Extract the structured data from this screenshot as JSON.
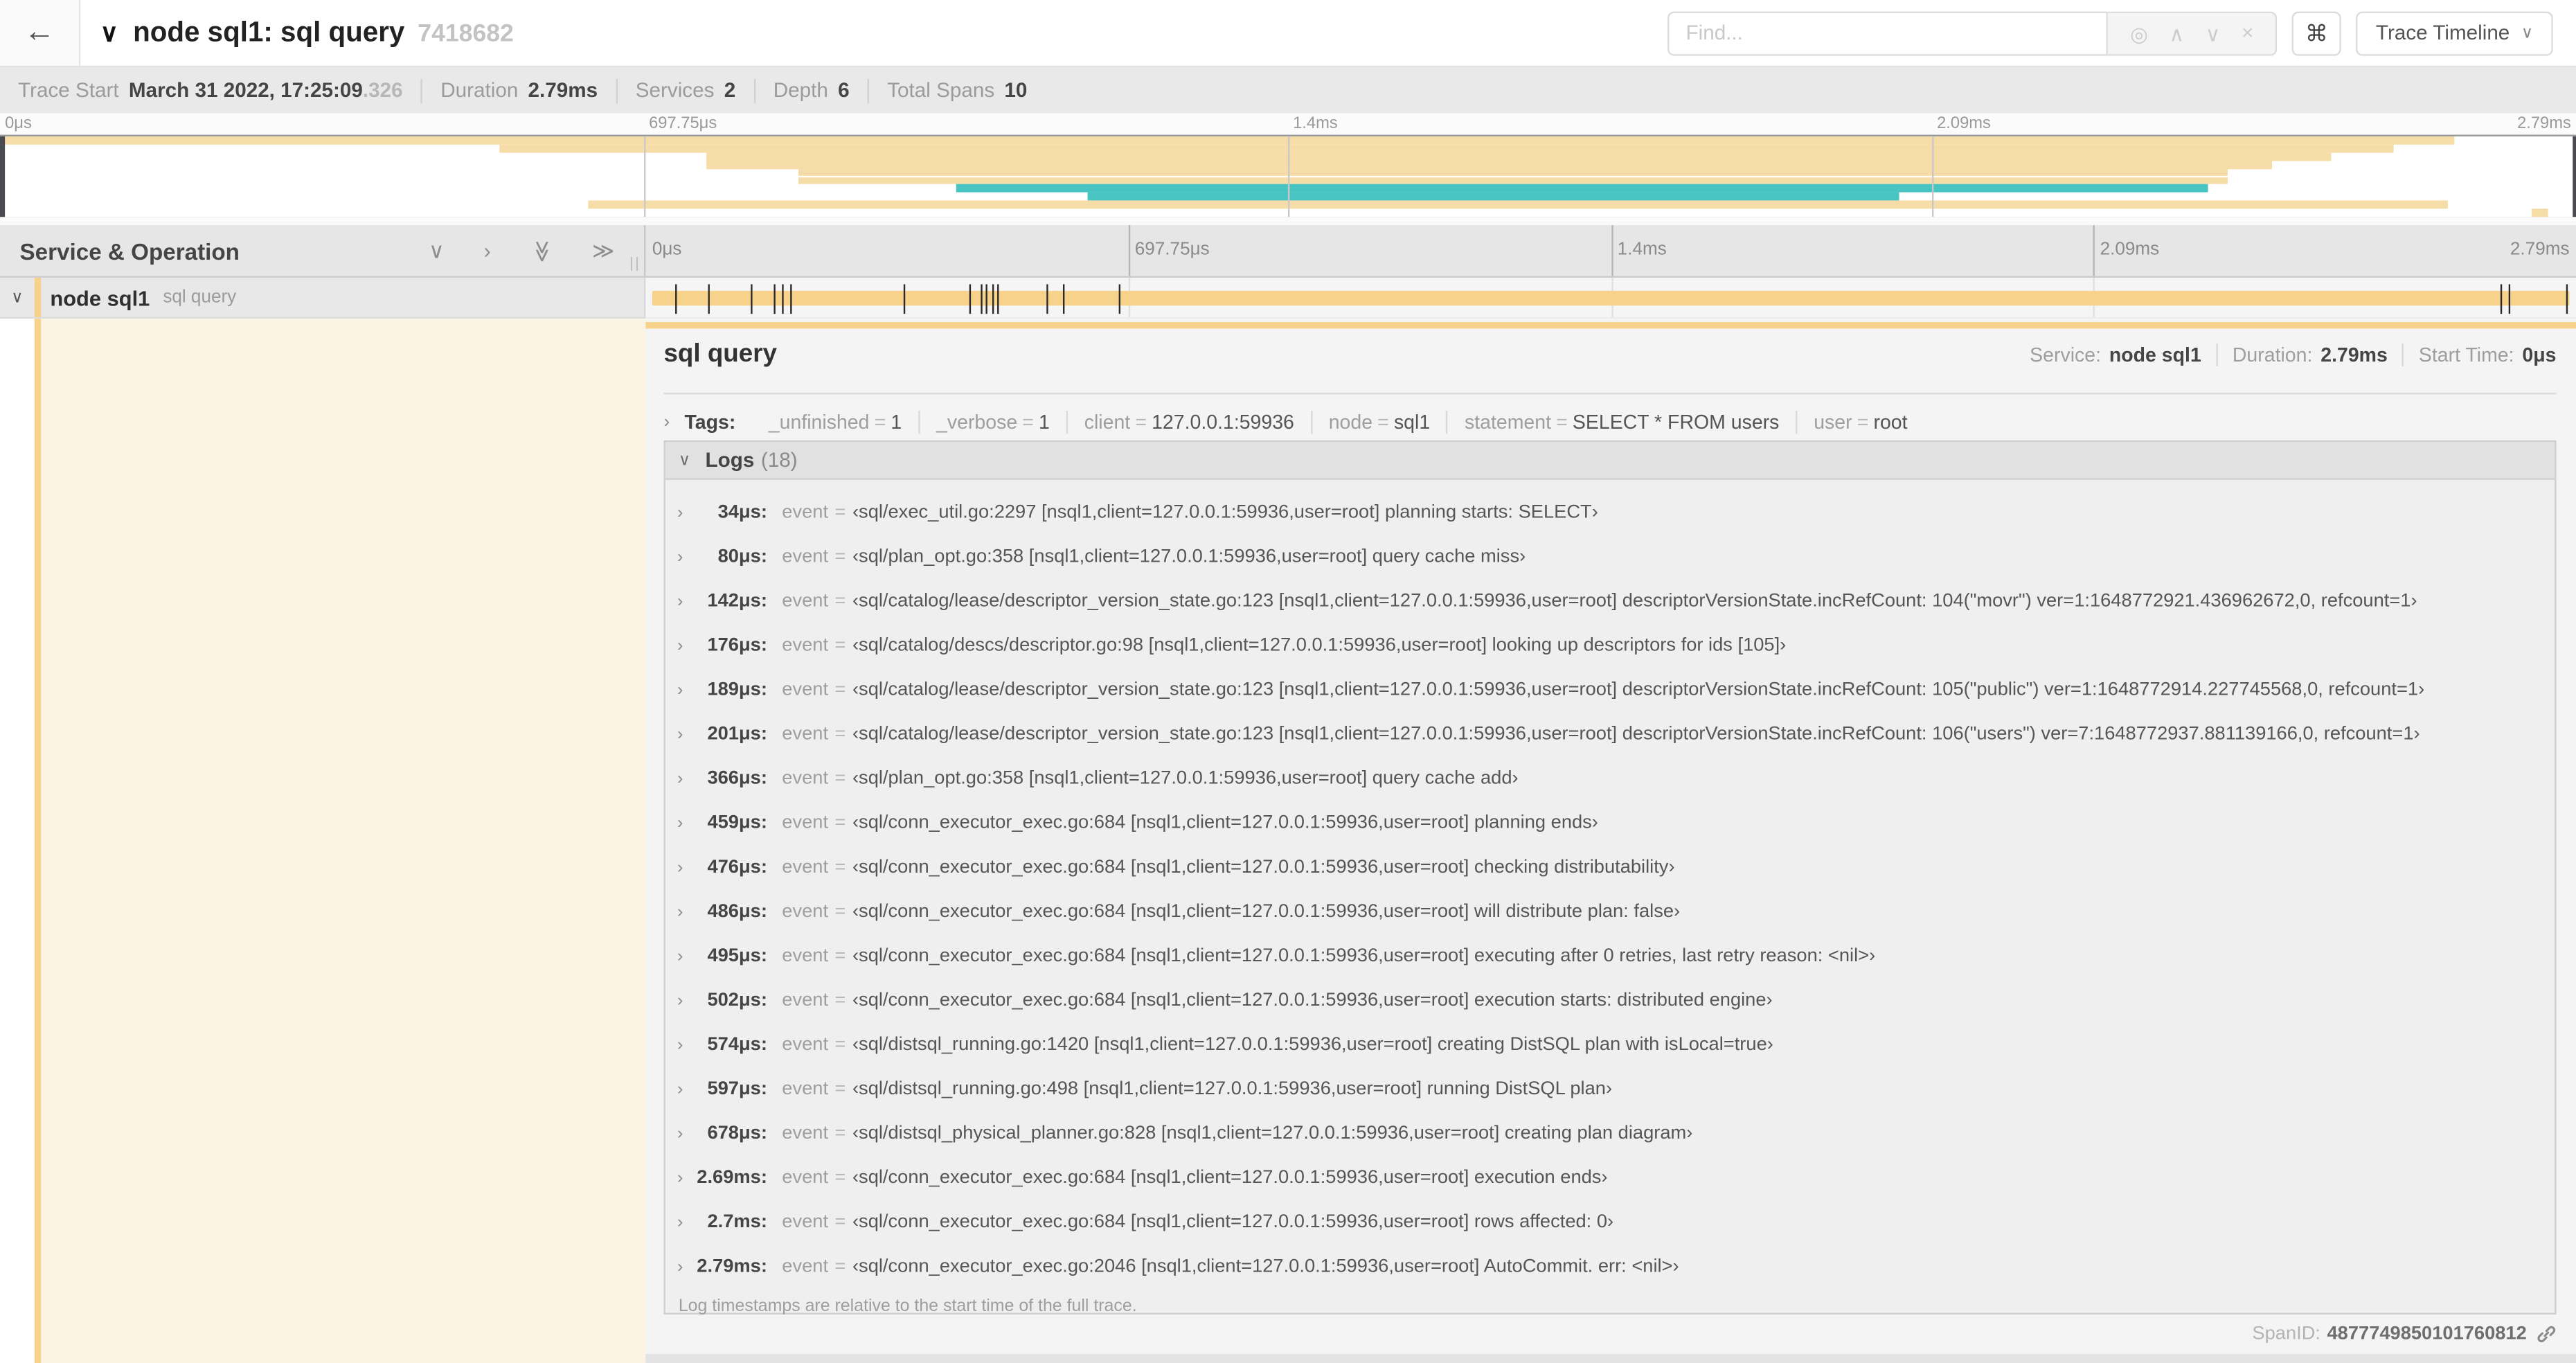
{
  "header": {
    "back_icon": "←",
    "collapse_icon": "∨",
    "title": "node sql1: sql query",
    "trace_id": "7418682",
    "find_placeholder": "Find...",
    "find_icons": [
      {
        "name": "locate-icon",
        "glyph": "◎"
      },
      {
        "name": "chevron-up-icon",
        "glyph": "∧"
      },
      {
        "name": "chevron-down-icon",
        "glyph": "∨"
      },
      {
        "name": "close-icon",
        "glyph": "×"
      }
    ],
    "shortcut_icon": "⌘",
    "view_selector": "Trace Timeline",
    "view_selector_chevron": "∨"
  },
  "trace_info": {
    "items": [
      {
        "label": "Trace Start",
        "value": "March 31 2022, 17:25:09",
        "suffix": ".326"
      },
      {
        "label": "Duration",
        "value": "2.79ms",
        "suffix": ""
      },
      {
        "label": "Services",
        "value": "2",
        "suffix": ""
      },
      {
        "label": "Depth",
        "value": "6",
        "suffix": ""
      },
      {
        "label": "Total Spans",
        "value": "10",
        "suffix": ""
      }
    ]
  },
  "minimap": {
    "time_labels": [
      "0μs",
      "697.75μs",
      "1.4ms",
      "2.09ms",
      "2.79ms"
    ],
    "label_positions": [
      0,
      25,
      50,
      75,
      100
    ],
    "colors": {
      "tan": "#F6DCA6",
      "teal": "#48C5C3"
    },
    "bars": [
      {
        "start": 0,
        "end": 95.3,
        "color": "tan"
      },
      {
        "start": 19.4,
        "end": 92.9,
        "color": "tan"
      },
      {
        "start": 27.4,
        "end": 90.5,
        "color": "tan"
      },
      {
        "start": 27.4,
        "end": 88.2,
        "color": "tan"
      },
      {
        "start": 31.0,
        "end": 86.5,
        "color": "tan"
      },
      {
        "start": 31.0,
        "end": 86.5,
        "color": "tan"
      },
      {
        "start": 37.1,
        "end": 85.7,
        "color": "teal"
      },
      {
        "start": 42.2,
        "end": 73.7,
        "color": "teal"
      },
      {
        "start": 22.8,
        "end": 95.0,
        "color": "tan"
      },
      {
        "start": 98.3,
        "end": 98.9,
        "color": "tan"
      }
    ]
  },
  "timeline": {
    "header": "Service & Operation",
    "header_icons": [
      {
        "name": "collapse-one-icon",
        "glyph": "∨",
        "rotate": false
      },
      {
        "name": "expand-one-icon",
        "glyph": "›",
        "rotate": false
      },
      {
        "name": "collapse-all-icon",
        "glyph": "≫",
        "rotate": true
      },
      {
        "name": "expand-all-icon",
        "glyph": "≫",
        "rotate": false
      }
    ],
    "grip": "||",
    "ruler_labels": [
      "0μs",
      "697.75μs",
      "1.4ms",
      "2.09ms",
      "2.79ms"
    ],
    "ruler_positions": [
      0,
      25,
      50,
      75,
      100
    ],
    "span": {
      "chevron": "∨",
      "service": "node sql1",
      "operation": "sql query",
      "bar_color": "#F7D28A"
    }
  },
  "detail": {
    "operation": "sql query",
    "summary": [
      {
        "label": "Service:",
        "value": "node sql1"
      },
      {
        "label": "Duration:",
        "value": "2.79ms"
      },
      {
        "label": "Start Time:",
        "value": "0μs"
      }
    ],
    "tags_chevron": "›",
    "tags_label": "Tags:",
    "tags": [
      {
        "key": "_unfinished",
        "value": "1"
      },
      {
        "key": "_verbose",
        "value": "1"
      },
      {
        "key": "client",
        "value": "127.0.0.1:59936"
      },
      {
        "key": "node",
        "value": "sql1"
      },
      {
        "key": "statement",
        "value": "SELECT * FROM users"
      },
      {
        "key": "user",
        "value": "root"
      }
    ],
    "logs_chevron": "∨",
    "logs_label": "Logs",
    "logs_count": "(18)",
    "logs": [
      {
        "time": "34μs:",
        "pct": 1.2,
        "key": "event",
        "value": "‹sql/exec_util.go:2297 [nsql1,client=127.0.0.1:59936,user=root] planning starts: SELECT›"
      },
      {
        "time": "80μs:",
        "pct": 2.9,
        "key": "event",
        "value": "‹sql/plan_opt.go:358 [nsql1,client=127.0.0.1:59936,user=root] query cache miss›"
      },
      {
        "time": "142μs:",
        "pct": 5.1,
        "key": "event",
        "value": "‹sql/catalog/lease/descriptor_version_state.go:123 [nsql1,client=127.0.0.1:59936,user=root] descriptorVersionState.incRefCount: 104(\"movr\") ver=1:1648772921.436962672,0, refcount=1›"
      },
      {
        "time": "176μs:",
        "pct": 6.3,
        "key": "event",
        "value": "‹sql/catalog/descs/descriptor.go:98 [nsql1,client=127.0.0.1:59936,user=root] looking up descriptors for ids [105]›"
      },
      {
        "time": "189μs:",
        "pct": 6.8,
        "key": "event",
        "value": "‹sql/catalog/lease/descriptor_version_state.go:123 [nsql1,client=127.0.0.1:59936,user=root] descriptorVersionState.incRefCount: 105(\"public\") ver=1:1648772914.227745568,0, refcount=1›"
      },
      {
        "time": "201μs:",
        "pct": 7.2,
        "key": "event",
        "value": "‹sql/catalog/lease/descriptor_version_state.go:123 [nsql1,client=127.0.0.1:59936,user=root] descriptorVersionState.incRefCount: 106(\"users\") ver=7:1648772937.881139166,0, refcount=1›"
      },
      {
        "time": "366μs:",
        "pct": 13.1,
        "key": "event",
        "value": "‹sql/plan_opt.go:358 [nsql1,client=127.0.0.1:59936,user=root] query cache add›"
      },
      {
        "time": "459μs:",
        "pct": 16.5,
        "key": "event",
        "value": "‹sql/conn_executor_exec.go:684 [nsql1,client=127.0.0.1:59936,user=root] planning ends›"
      },
      {
        "time": "476μs:",
        "pct": 17.1,
        "key": "event",
        "value": "‹sql/conn_executor_exec.go:684 [nsql1,client=127.0.0.1:59936,user=root] checking distributability›"
      },
      {
        "time": "486μs:",
        "pct": 17.4,
        "key": "event",
        "value": "‹sql/conn_executor_exec.go:684 [nsql1,client=127.0.0.1:59936,user=root] will distribute plan: false›"
      },
      {
        "time": "495μs:",
        "pct": 17.7,
        "key": "event",
        "value": "‹sql/conn_executor_exec.go:684 [nsql1,client=127.0.0.1:59936,user=root] executing after 0 retries, last retry reason: <nil>›"
      },
      {
        "time": "502μs:",
        "pct": 18.0,
        "key": "event",
        "value": "‹sql/conn_executor_exec.go:684 [nsql1,client=127.0.0.1:59936,user=root] execution starts: distributed engine›"
      },
      {
        "time": "574μs:",
        "pct": 20.6,
        "key": "event",
        "value": "‹sql/distsql_running.go:1420 [nsql1,client=127.0.0.1:59936,user=root] creating DistSQL plan with isLocal=true›"
      },
      {
        "time": "597μs:",
        "pct": 21.4,
        "key": "event",
        "value": "‹sql/distsql_running.go:498 [nsql1,client=127.0.0.1:59936,user=root] running DistSQL plan›"
      },
      {
        "time": "678μs:",
        "pct": 24.3,
        "key": "event",
        "value": "‹sql/distsql_physical_planner.go:828 [nsql1,client=127.0.0.1:59936,user=root] creating plan diagram›"
      },
      {
        "time": "2.69ms:",
        "pct": 96.4,
        "key": "event",
        "value": "‹sql/conn_executor_exec.go:684 [nsql1,client=127.0.0.1:59936,user=root] execution ends›"
      },
      {
        "time": "2.7ms:",
        "pct": 96.8,
        "key": "event",
        "value": "‹sql/conn_executor_exec.go:684 [nsql1,client=127.0.0.1:59936,user=root] rows affected: 0›"
      },
      {
        "time": "2.79ms:",
        "pct": 99.8,
        "key": "event",
        "value": "‹sql/conn_executor_exec.go:2046 [nsql1,client=127.0.0.1:59936,user=root] AutoCommit. err: <nil>›"
      }
    ],
    "logs_footer": "Log timestamps are relative to the start time of the full trace.",
    "span_id_label": "SpanID:",
    "span_id": "4877749850101760812"
  }
}
